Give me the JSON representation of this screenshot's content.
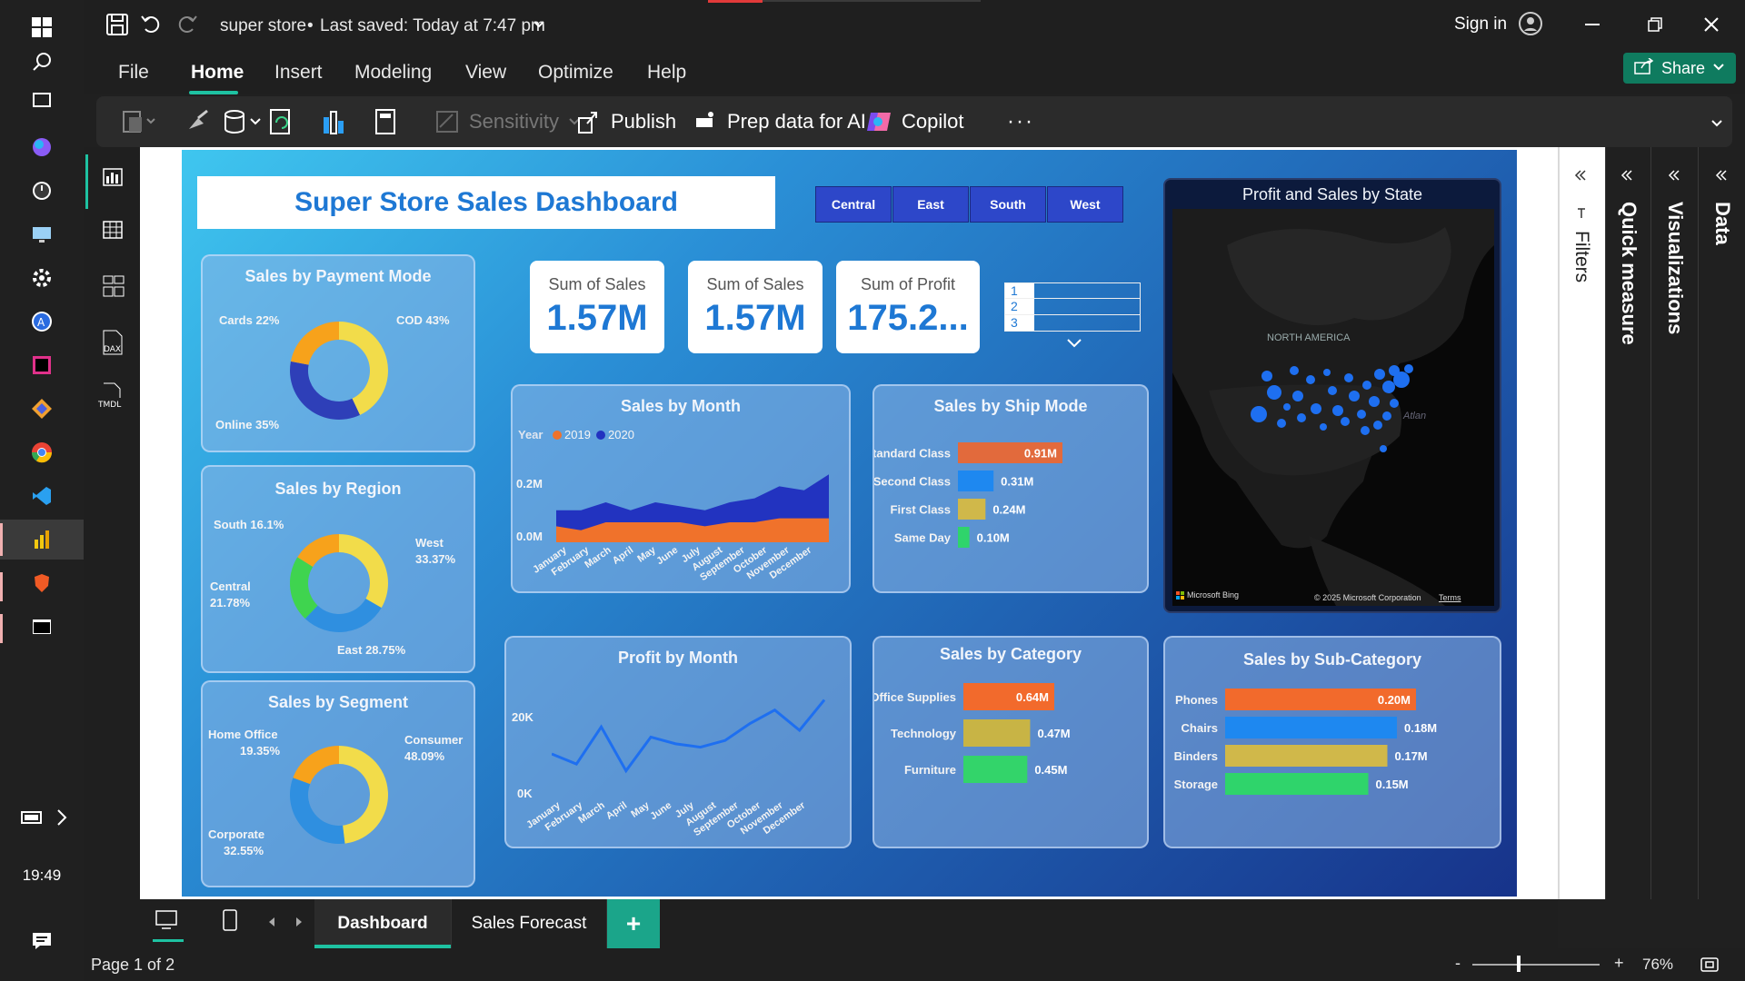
{
  "titlebar": {
    "doc_title": "super store",
    "saved_status": "Last saved: Today at 7:47 pm",
    "sign_in": "Sign in"
  },
  "menu": {
    "items": [
      "File",
      "Home",
      "Insert",
      "Modeling",
      "View",
      "Optimize",
      "Help"
    ],
    "active": "Home",
    "share": "Share"
  },
  "ribbon": {
    "sensitivity": "Sensitivity",
    "publish": "Publish",
    "prep_data": "Prep data for AI",
    "copilot": "Copilot",
    "more": "···"
  },
  "taskbar": {
    "time": "19:49"
  },
  "report": {
    "title": "Super Store Sales Dashboard",
    "regions": [
      "Central",
      "East",
      "South",
      "West"
    ],
    "kpis": [
      {
        "label": "Sum of Sales",
        "value": "1.57M"
      },
      {
        "label": "Sum of Sales",
        "value": "1.57M"
      },
      {
        "label": "Sum of Profit",
        "value": "175.2..."
      }
    ],
    "slicer_items": [
      "1",
      "2",
      "3"
    ],
    "payment": {
      "title": "Sales by Payment Mode",
      "labels": [
        "Cards 22%",
        "COD 43%",
        "Online 35%"
      ]
    },
    "region_chart": {
      "title": "Sales by Region",
      "labels": [
        "South 16.1%",
        "West",
        "33.37%",
        "Central",
        "21.78%",
        "East 28.75%"
      ]
    },
    "segment": {
      "title": "Sales by Segment",
      "labels": [
        "Home Office",
        "19.35%",
        "Consumer",
        "48.09%",
        "Corporate",
        "32.55%"
      ]
    },
    "month": {
      "title": "Sales by Month",
      "legend_title": "Year",
      "legend": [
        "2019",
        "2020"
      ],
      "y_ticks": [
        "0.2M",
        "0.0M"
      ],
      "months": [
        "January",
        "February",
        "March",
        "April",
        "May",
        "June",
        "July",
        "August",
        "September",
        "October",
        "November",
        "December"
      ]
    },
    "ship": {
      "title": "Sales by Ship Mode"
    },
    "map": {
      "title": "Profit and Sales by State",
      "label": "NORTH AMERICA",
      "bing": "Microsoft Bing",
      "copyright": "© 2025 Microsoft Corporation",
      "terms": "Terms",
      "atlantic": "Atlan"
    },
    "profit_month": {
      "title": "Profit by Month",
      "y_ticks": [
        "20K",
        "0K"
      ]
    },
    "category": {
      "title": "Sales by Category"
    },
    "subcat": {
      "title": "Sales by Sub-Category"
    }
  },
  "chart_data": [
    {
      "type": "pie",
      "title": "Sales by Payment Mode",
      "categories": [
        "COD",
        "Online",
        "Cards"
      ],
      "values": [
        43,
        35,
        22
      ],
      "colors": [
        "#f2dc4a",
        "#2e3fb8",
        "#f7a21b"
      ]
    },
    {
      "type": "pie",
      "title": "Sales by Region",
      "categories": [
        "West",
        "East",
        "Central",
        "South"
      ],
      "values": [
        33.37,
        28.75,
        21.78,
        16.1
      ],
      "colors": [
        "#f2dc4a",
        "#2f8fe0",
        "#3fd44f",
        "#f7a21b"
      ]
    },
    {
      "type": "pie",
      "title": "Sales by Segment",
      "categories": [
        "Consumer",
        "Corporate",
        "Home Office"
      ],
      "values": [
        48.09,
        32.55,
        19.35
      ],
      "colors": [
        "#f2dc4a",
        "#2f8fe0",
        "#f7a21b"
      ]
    },
    {
      "type": "area",
      "title": "Sales by Month",
      "x": [
        "January",
        "February",
        "March",
        "April",
        "May",
        "June",
        "July",
        "August",
        "September",
        "October",
        "November",
        "December"
      ],
      "series": [
        {
          "name": "2019",
          "values": [
            0.04,
            0.03,
            0.05,
            0.05,
            0.05,
            0.05,
            0.04,
            0.05,
            0.05,
            0.06,
            0.06,
            0.06
          ],
          "color": "#f0722b"
        },
        {
          "name": "2020",
          "values": [
            0.08,
            0.08,
            0.1,
            0.08,
            0.1,
            0.09,
            0.08,
            0.1,
            0.11,
            0.14,
            0.13,
            0.17
          ],
          "color": "#2233c0"
        }
      ],
      "ylim": [
        0,
        0.25
      ]
    },
    {
      "type": "bar",
      "title": "Sales by Ship Mode",
      "categories": [
        "Standard Class",
        "Second Class",
        "First Class",
        "Same Day"
      ],
      "values": [
        0.91,
        0.31,
        0.24,
        0.1
      ],
      "labels": [
        "0.91M",
        "0.31M",
        "0.24M",
        "0.10M"
      ],
      "colors": [
        "#e26a3c",
        "#1e88f0",
        "#d0b84a",
        "#2fd46b"
      ],
      "max": 0.91
    },
    {
      "type": "line",
      "title": "Profit by Month",
      "x": [
        "January",
        "February",
        "March",
        "April",
        "May",
        "June",
        "July",
        "August",
        "September",
        "October",
        "November",
        "December"
      ],
      "values": [
        14,
        11,
        22,
        9,
        19,
        17,
        16,
        18,
        23,
        27,
        21,
        30
      ],
      "ylim": [
        0,
        35
      ],
      "color": "#1e6ff0"
    },
    {
      "type": "bar",
      "title": "Sales by Category",
      "categories": [
        "Office Supplies",
        "Technology",
        "Furniture"
      ],
      "values": [
        0.64,
        0.47,
        0.45
      ],
      "labels": [
        "0.64M",
        "0.47M",
        "0.45M"
      ],
      "colors": [
        "#f26a2c",
        "#c8b445",
        "#33d46a"
      ],
      "max": 0.64
    },
    {
      "type": "bar",
      "title": "Sales by Sub-Category",
      "categories": [
        "Phones",
        "Chairs",
        "Binders",
        "Storage"
      ],
      "values": [
        0.2,
        0.18,
        0.17,
        0.15
      ],
      "labels": [
        "0.20M",
        "0.18M",
        "0.17M",
        "0.15M"
      ],
      "colors": [
        "#f26a2c",
        "#1e88f0",
        "#d0b84a",
        "#2fd46b"
      ],
      "max": 0.2
    }
  ],
  "side_panels": {
    "filters": "Filters",
    "quick_measure": "Quick measure",
    "visualizations": "Visualizations",
    "data": "Data"
  },
  "tabs": {
    "items": [
      "Dashboard",
      "Sales Forecast"
    ],
    "add": "+"
  },
  "status": {
    "page": "Page 1 of 2",
    "zoom": "76%",
    "zoom_minus": "-",
    "zoom_plus": "+"
  }
}
